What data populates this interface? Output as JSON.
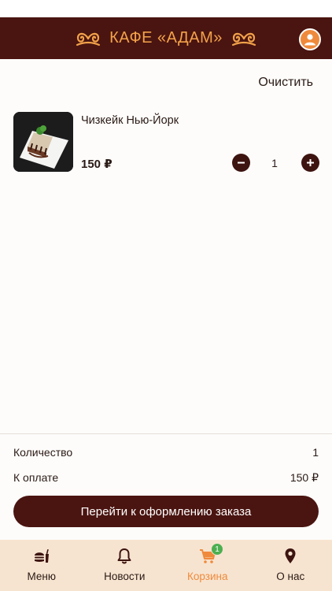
{
  "header": {
    "title": "КАФЕ «АДАМ»"
  },
  "cart": {
    "clear_label": "Очистить",
    "items": [
      {
        "name": "Чизкейк Нью-Йорк",
        "price": "150 ₽",
        "quantity": "1"
      }
    ]
  },
  "summary": {
    "quantity_label": "Количество",
    "quantity_value": "1",
    "pay_label": "К оплате",
    "pay_value": "150 ₽",
    "checkout_label": "Перейти к оформлению заказа"
  },
  "tabbar": {
    "items": [
      {
        "label": "Меню",
        "icon": "burger-icon"
      },
      {
        "label": "Новости",
        "icon": "bell-icon"
      },
      {
        "label": "Корзина",
        "icon": "cart-icon",
        "badge": "1",
        "active": true
      },
      {
        "label": "О нас",
        "icon": "location-pin-icon"
      }
    ]
  },
  "colors": {
    "brand": "#4a1410",
    "accent": "#ef8a3c",
    "tabbar_bg": "#f7e4d0",
    "badge": "#4caf50"
  }
}
